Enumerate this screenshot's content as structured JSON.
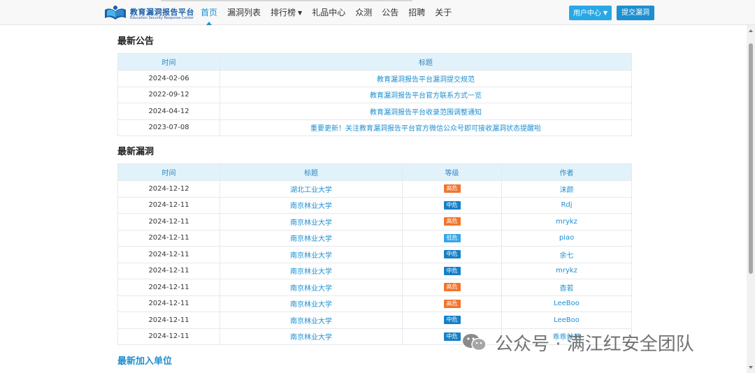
{
  "header": {
    "logo_title": "教育漏洞报告平台",
    "logo_subtitle": "Education Security Response Center",
    "nav": [
      {
        "label": "首页",
        "active": true
      },
      {
        "label": "漏洞列表"
      },
      {
        "label": "排行榜",
        "dropdown": true
      },
      {
        "label": "礼品中心"
      },
      {
        "label": "众测"
      },
      {
        "label": "公告"
      },
      {
        "label": "招聘"
      },
      {
        "label": "关于"
      }
    ],
    "user_center_label": "用户中心",
    "submit_label": "提交漏洞"
  },
  "announcements": {
    "title": "最新公告",
    "columns": [
      "时间",
      "标题"
    ],
    "rows": [
      {
        "date": "2024-02-06",
        "title": "教育漏洞报告平台漏洞提交规范"
      },
      {
        "date": "2022-09-12",
        "title": "教育漏洞报告平台官方联系方式一览"
      },
      {
        "date": "2024-04-12",
        "title": "教育漏洞报告平台收录范围调整通知"
      },
      {
        "date": "2023-07-08",
        "title": "重要更新！关注教育漏洞报告平台官方微信公众号即可接收漏洞状态提醒啦"
      }
    ]
  },
  "vulns": {
    "title": "最新漏洞",
    "columns": [
      "时间",
      "标题",
      "等级",
      "作者"
    ],
    "rows": [
      {
        "date": "2024-12-12",
        "title": "湖北工业大学",
        "level": "高危",
        "level_type": "high",
        "author": "沫颜"
      },
      {
        "date": "2024-12-11",
        "title": "南京林业大学",
        "level": "中危",
        "level_type": "mid",
        "author": "Rdj"
      },
      {
        "date": "2024-12-11",
        "title": "南京林业大学",
        "level": "高危",
        "level_type": "high",
        "author": "mrykz"
      },
      {
        "date": "2024-12-11",
        "title": "南京林业大学",
        "level": "低危",
        "level_type": "low",
        "author": "piao"
      },
      {
        "date": "2024-12-11",
        "title": "南京林业大学",
        "level": "中危",
        "level_type": "mid",
        "author": "余七"
      },
      {
        "date": "2024-12-11",
        "title": "南京林业大学",
        "level": "中危",
        "level_type": "mid",
        "author": "mrykz"
      },
      {
        "date": "2024-12-11",
        "title": "南京林业大学",
        "level": "高危",
        "level_type": "high",
        "author": "杳若"
      },
      {
        "date": "2024-12-11",
        "title": "南京林业大学",
        "level": "高危",
        "level_type": "high",
        "author": "LeeBoo"
      },
      {
        "date": "2024-12-11",
        "title": "南京林业大学",
        "level": "中危",
        "level_type": "mid",
        "author": "LeeBoo"
      },
      {
        "date": "2024-12-11",
        "title": "南京林业大学",
        "level": "中危",
        "level_type": "mid",
        "author": "乖乖就范"
      }
    ]
  },
  "new_units": {
    "title": "最新加入单位"
  },
  "watermark": {
    "text": "公众号 · 满江红安全团队"
  },
  "colors": {
    "accent": "#1e8fd0",
    "header_bg": "#e2f2fa",
    "high": "#f0752e",
    "mid": "#1580c8",
    "low": "#36a7e6"
  }
}
